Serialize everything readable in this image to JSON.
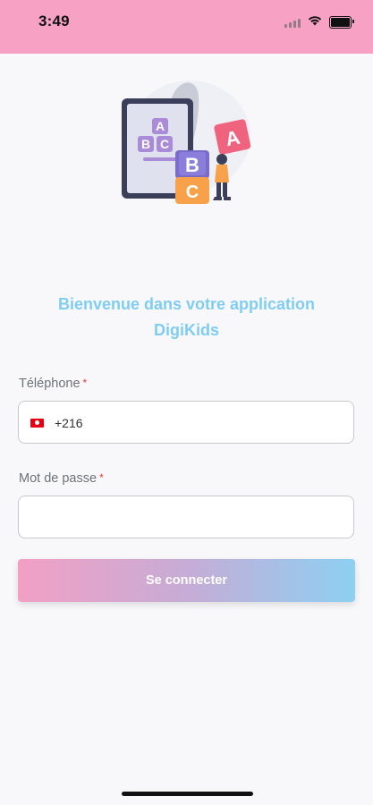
{
  "status_bar": {
    "time": "3:49",
    "background": "#f7a1c4"
  },
  "illustration": {
    "block_letters": [
      "A",
      "B",
      "C",
      "B",
      "C",
      "A"
    ]
  },
  "welcome": {
    "line1": "Bienvenue dans votre application",
    "line2": "DigiKids",
    "color": "#7fcdf2"
  },
  "phone_field": {
    "label": "Téléphone",
    "required_mark": "*",
    "flag_icon": "tunisia-flag-icon",
    "dial_code": "+216",
    "value": ""
  },
  "password_field": {
    "label": "Mot de passe",
    "required_mark": "*",
    "value": ""
  },
  "login_button": {
    "label": "Se connecter",
    "gradient_start": "#f2a0c4",
    "gradient_end": "#8dd0f2"
  }
}
